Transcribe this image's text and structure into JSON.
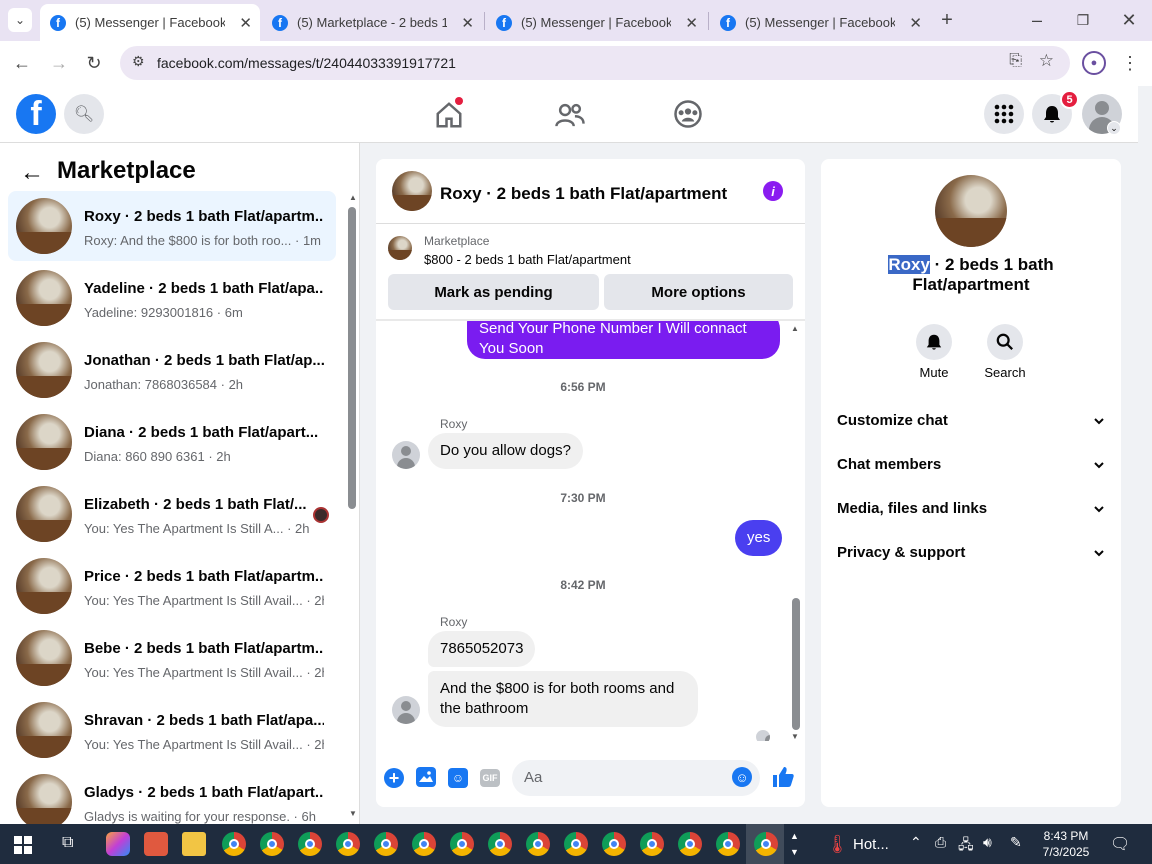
{
  "browser": {
    "tabs": [
      {
        "title": "(5) Messenger | Facebook",
        "active": true
      },
      {
        "title": "(5) Marketplace - 2 beds 1 b",
        "active": false
      },
      {
        "title": "(5) Messenger | Facebook",
        "active": false
      },
      {
        "title": "(5) Messenger | Facebook",
        "active": false
      }
    ],
    "url": "facebook.com/messages/t/24044033391917721"
  },
  "fb_nav": {
    "notification_count": "5"
  },
  "left_pane": {
    "title": "Marketplace",
    "conversations": [
      {
        "name": "Roxy · 2 beds 1 bath Flat/apartm...",
        "preview": "Roxy: And the $800 is for both roo... · 1m"
      },
      {
        "name": "Yadeline · 2 beds 1 bath Flat/apa...",
        "preview": "Yadeline: 9293001816 · 6m"
      },
      {
        "name": "Jonathan · 2 beds 1 bath Flat/ap...",
        "preview": "Jonathan: 7868036584 · 2h"
      },
      {
        "name": "Diana · 2 beds 1 bath Flat/apart...",
        "preview": "Diana: 860 890 6361 · 2h"
      },
      {
        "name": "Elizabeth · 2 beds 1 bath Flat/...",
        "preview": "You: Yes The Apartment Is Still A... · 2h"
      },
      {
        "name": "Price · 2 beds 1 bath Flat/apartm...",
        "preview": "You: Yes The Apartment Is Still Avail... · 2h"
      },
      {
        "name": "Bebe · 2 beds 1 bath Flat/apartm...",
        "preview": "You: Yes The Apartment Is Still Avail... · 2h"
      },
      {
        "name": "Shravan · 2 beds 1 bath Flat/apa...",
        "preview": "You: Yes The Apartment Is Still Avail... · 2h"
      },
      {
        "name": "Gladys · 2 beds 1 bath Flat/apart...",
        "preview": "Gladys is waiting for your response. · 6h"
      }
    ]
  },
  "chat": {
    "header_title": "Roxy · 2 beds 1 bath Flat/apartment",
    "listing_label": "Marketplace",
    "listing_title": "$800 - 2 beds 1 bath Flat/apartment",
    "mark_pending": "Mark as pending",
    "more_options": "More options",
    "messages": {
      "out1": "Send Your Phone Number I Will connact You Soon",
      "time1": "6:56 PM",
      "sender": "Roxy",
      "in1": "Do you allow dogs?",
      "time2": "7:30 PM",
      "out2": "yes",
      "time3": "8:42 PM",
      "in2": "7865052073",
      "in3": "And the $800 is for both rooms and the bathroom"
    },
    "input_placeholder": "Aa"
  },
  "right_pane": {
    "name_highlight": "Roxy",
    "name_rest": " · 2 beds 1 bath",
    "name_line2": "Flat/apartment",
    "mute": "Mute",
    "search": "Search",
    "sections": [
      "Customize chat",
      "Chat members",
      "Media, files and links",
      "Privacy & support"
    ]
  },
  "taskbar": {
    "weather": "Hot...",
    "time": "8:43 PM",
    "date": "7/3/2025"
  },
  "colors": {
    "fb_blue": "#1877f2",
    "messenger_purple": "#7a1cf0",
    "notif_red": "#e41e3f"
  }
}
